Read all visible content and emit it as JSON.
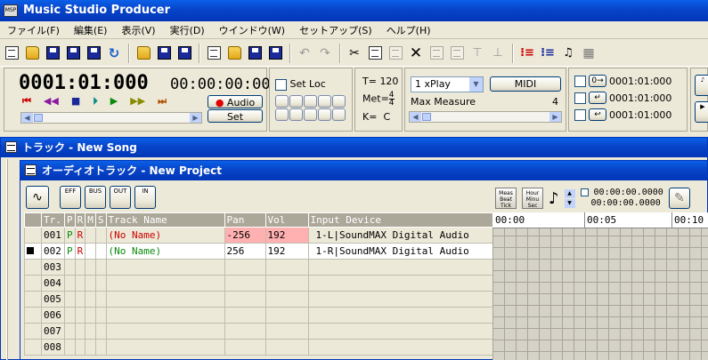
{
  "app": {
    "title": "Music Studio Producer",
    "icon_label": "MSP"
  },
  "menu": [
    "ファイル(F)",
    "編集(E)",
    "表示(V)",
    "実行(D)",
    "ウインドウ(W)",
    "セットアップ(S)",
    "ヘルプ(H)"
  ],
  "transport": {
    "position": "0001:01:000",
    "time": "00:00:00:00",
    "audio_label": "Audio",
    "set_label": "Set"
  },
  "setloc": {
    "label": "Set Loc"
  },
  "tempo": {
    "t_label": "T=",
    "t_value": "120",
    "met_label": "Met=",
    "met_num": "4",
    "met_den": "4",
    "key_label": "K=",
    "key_value": "C"
  },
  "play": {
    "mode": "1 xPlay",
    "midi_label": "MIDI",
    "max_measure_label": "Max Measure",
    "max_measure_value": "4"
  },
  "locators": [
    "0001:01:000",
    "0001:01:000",
    "0001:01:000"
  ],
  "track_window": {
    "title": "トラック - New Song"
  },
  "audio_window": {
    "title": "オーディオトラック - New Project"
  },
  "audio_toolbar": {
    "buttons": [
      "EFF",
      "BUS",
      "OUT",
      "IN"
    ],
    "meas_beat_tick": "Meas Beat Tick",
    "hour_min_sec": "Hour Minu Sec",
    "time1": "00:00:00.0000",
    "time2": "00:00:00.0000"
  },
  "columns": [
    "Tr.",
    "P",
    "R",
    "M",
    "S",
    "Track Name",
    "Pan",
    "Vol",
    "Input Device"
  ],
  "tracks": [
    {
      "num": "001",
      "p": "P",
      "r": "R",
      "name": "(No Name)",
      "pan": "-256",
      "vol": "192",
      "input": "1-L|SoundMAX Digital Audio",
      "selected": false
    },
    {
      "num": "002",
      "p": "P",
      "r": "R",
      "name": "(No Name)",
      "pan": "256",
      "vol": "192",
      "input": "1-R|SoundMAX Digital Audio",
      "selected": true
    },
    {
      "num": "003"
    },
    {
      "num": "004"
    },
    {
      "num": "005"
    },
    {
      "num": "006"
    },
    {
      "num": "007"
    },
    {
      "num": "008"
    }
  ],
  "timeline": [
    "00:00",
    "00:05",
    "00:10"
  ],
  "colors": {
    "title_bar": "#0a5fe8",
    "face": "#ece9d8",
    "record_red": "#c00000",
    "pan_neg": "#ffb0b0",
    "pan_pos": "#c7ebdc"
  }
}
